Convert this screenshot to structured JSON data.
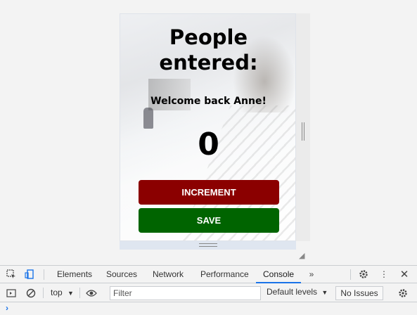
{
  "app": {
    "title": "People entered:",
    "welcome": "Welcome back Anne!",
    "count": "0",
    "increment_label": "INCREMENT",
    "save_label": "SAVE"
  },
  "devtools": {
    "tabs": [
      {
        "label": "Elements",
        "active": false
      },
      {
        "label": "Sources",
        "active": false
      },
      {
        "label": "Network",
        "active": false
      },
      {
        "label": "Performance",
        "active": false
      },
      {
        "label": "Console",
        "active": true
      }
    ],
    "context": "top",
    "filter_placeholder": "Filter",
    "levels": "Default levels",
    "issues": "No Issues",
    "prompt": "›"
  },
  "colors": {
    "increment_button": "#8b0000",
    "save_button": "#006400",
    "active_tab": "#1a73e8"
  }
}
